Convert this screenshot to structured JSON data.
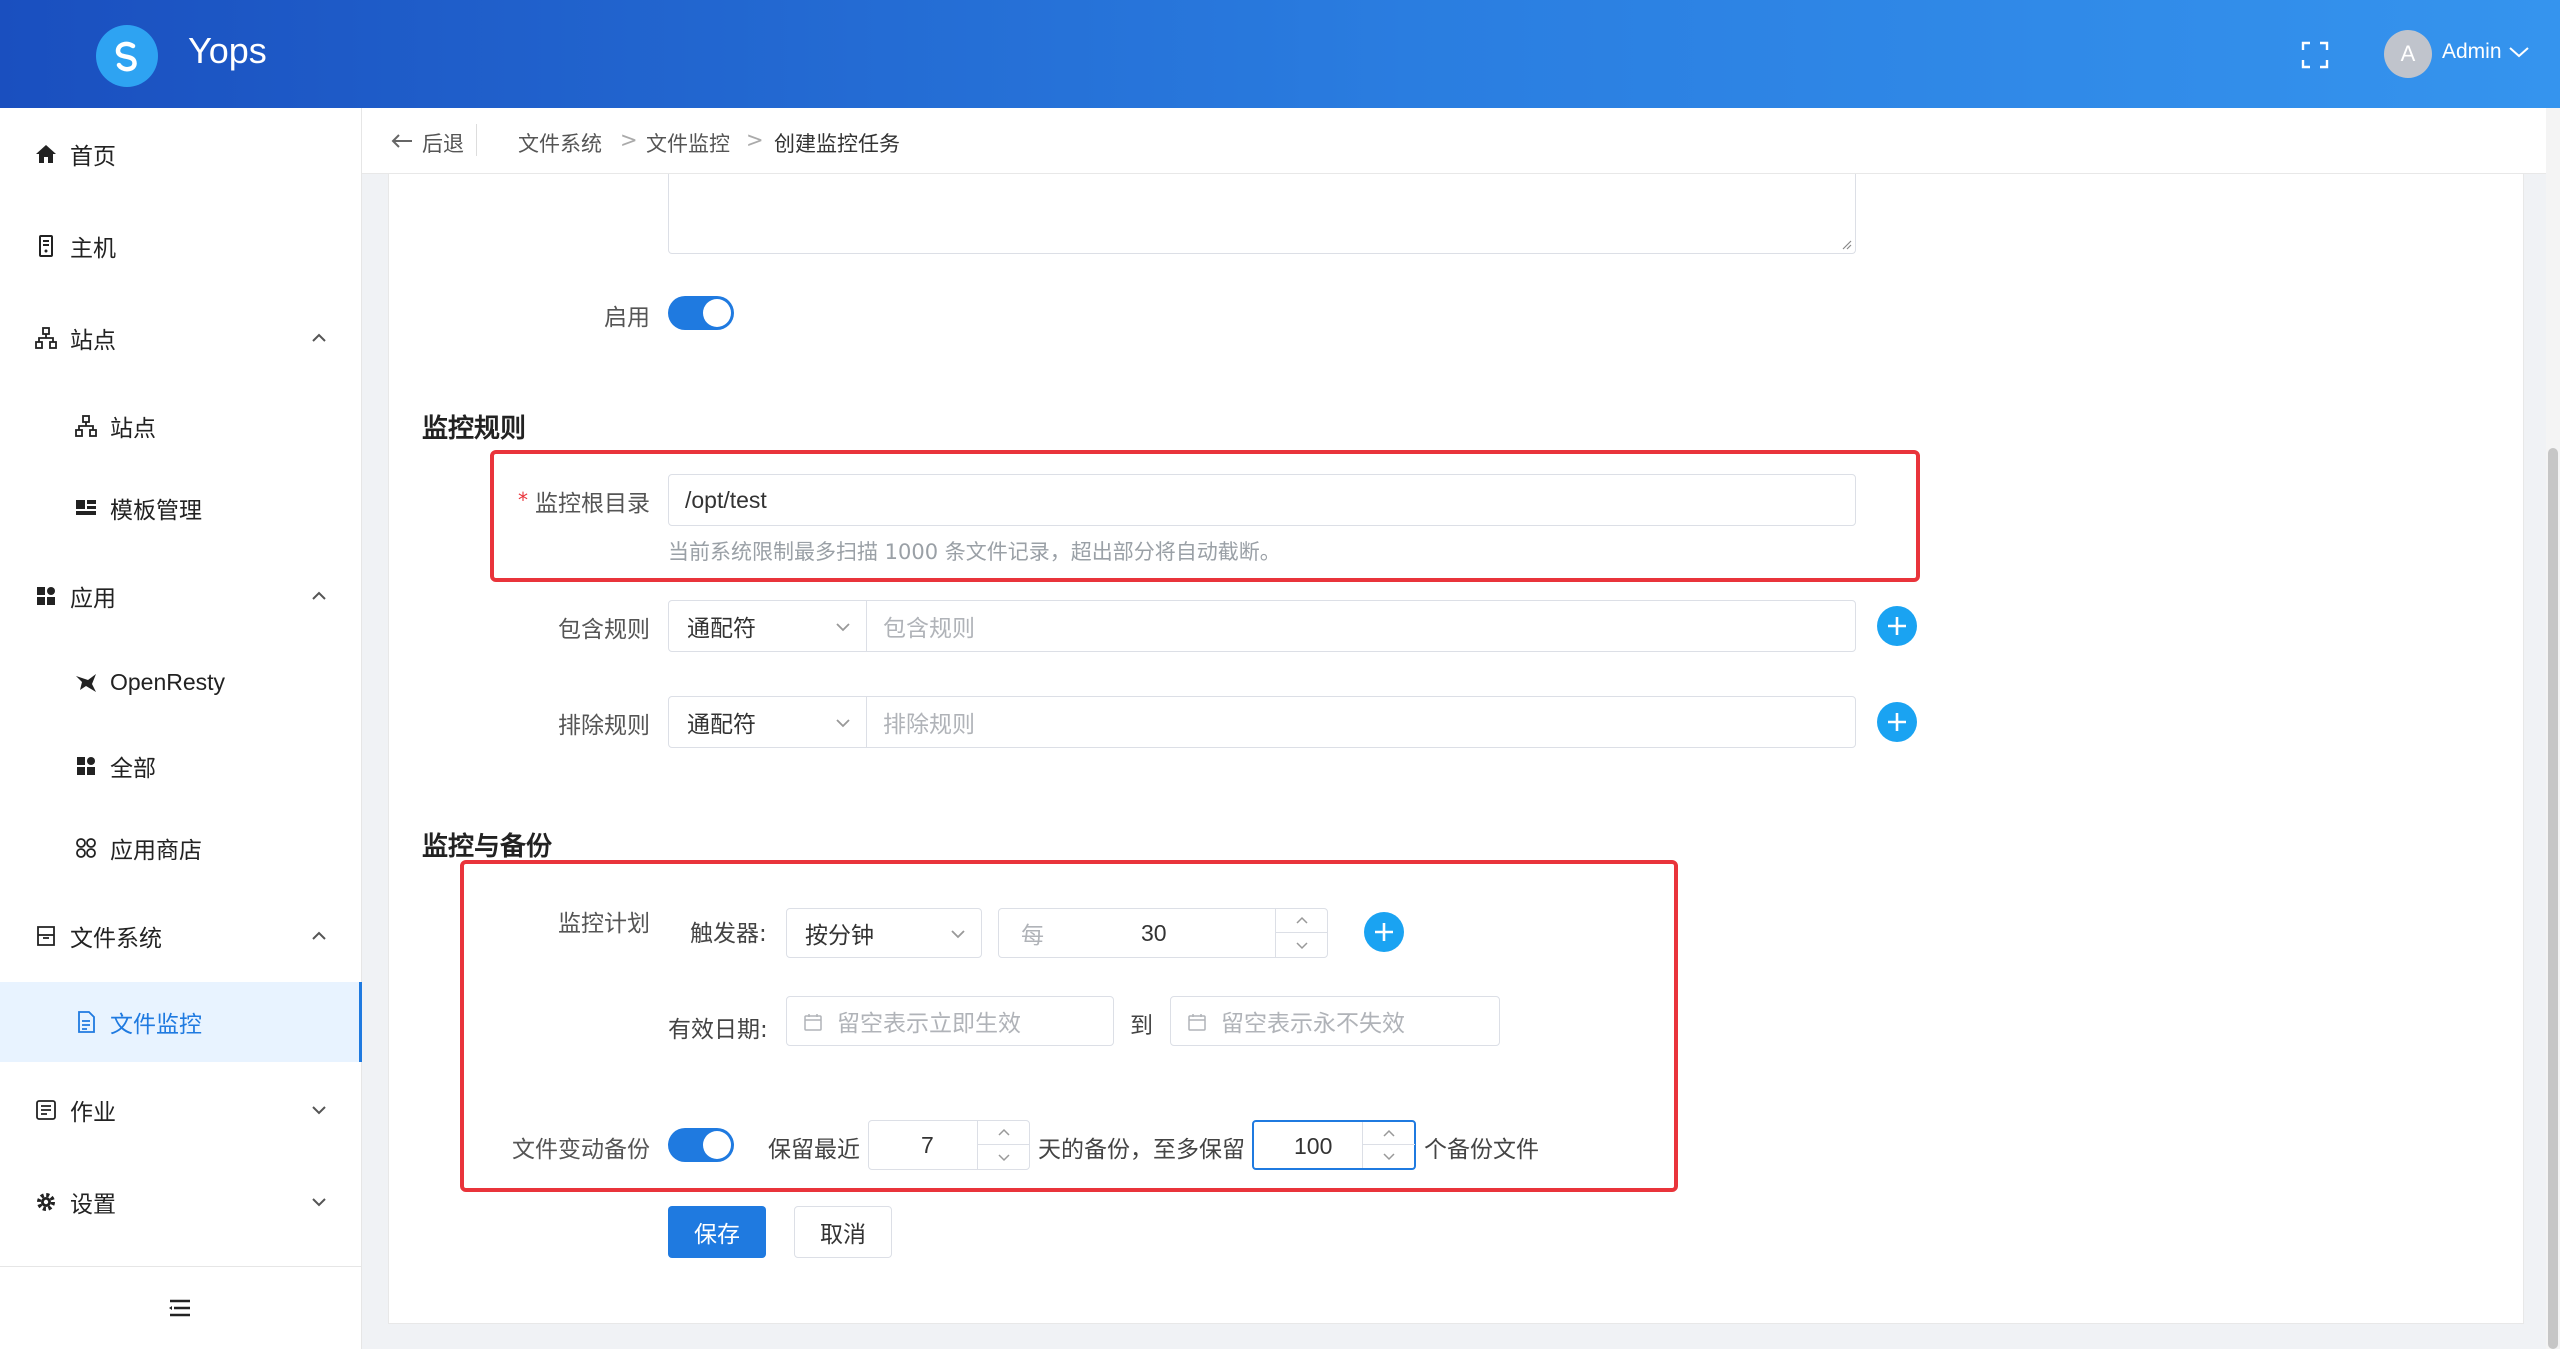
{
  "header": {
    "brand": "Yops",
    "user_initial": "A",
    "username": "Admin"
  },
  "sidebar": {
    "items": [
      {
        "label": "首页",
        "icon": "home-icon"
      },
      {
        "label": "主机",
        "icon": "server-icon"
      },
      {
        "label": "站点",
        "icon": "sitemap-icon",
        "expanded": true
      },
      {
        "label": "站点",
        "icon": "sitemap-icon"
      },
      {
        "label": "模板管理",
        "icon": "template-icon"
      },
      {
        "label": "应用",
        "icon": "apps-icon",
        "expanded": true
      },
      {
        "label": "OpenResty",
        "icon": "openresty-icon"
      },
      {
        "label": "全部",
        "icon": "apps-icon"
      },
      {
        "label": "应用商店",
        "icon": "store-icon"
      },
      {
        "label": "文件系统",
        "icon": "filesystem-icon",
        "expanded": true
      },
      {
        "label": "文件监控",
        "icon": "file-monitor-icon",
        "active": true
      },
      {
        "label": "作业",
        "icon": "job-icon",
        "expanded": false
      },
      {
        "label": "设置",
        "icon": "gear-icon",
        "expanded": false
      }
    ]
  },
  "breadcrumb": {
    "back": "后退",
    "items": [
      "文件系统",
      "文件监控",
      "创建监控任务"
    ]
  },
  "form": {
    "enable_label": "启用",
    "section_rules": "监控规则",
    "root_label": "监控根目录",
    "root_value": "/opt/test",
    "root_hint": "当前系统限制最多扫描 1000 条文件记录，超出部分将自动截断。",
    "include_label": "包含规则",
    "include_type": "通配符",
    "include_placeholder": "包含规则",
    "exclude_label": "排除规则",
    "exclude_type": "通配符",
    "exclude_placeholder": "排除规则",
    "section_backup": "监控与备份",
    "plan_label": "监控计划",
    "trigger_label": "触发器:",
    "trigger_value": "按分钟",
    "every_prefix": "每",
    "every_value": "30",
    "valid_label": "有效日期:",
    "start_placeholder": "留空表示立即生效",
    "to_text": "到",
    "end_placeholder": "留空表示永不失效",
    "backup_label": "文件变动备份",
    "keep_recent": "保留最近",
    "days_value": "7",
    "days_text": "天的备份，至多保留",
    "files_value": "100",
    "files_text": "个备份文件",
    "save": "保存",
    "cancel": "取消"
  },
  "colors": {
    "primary": "#1f7ae0",
    "accent": "#1aa3f2",
    "highlight": "#e9343b"
  }
}
